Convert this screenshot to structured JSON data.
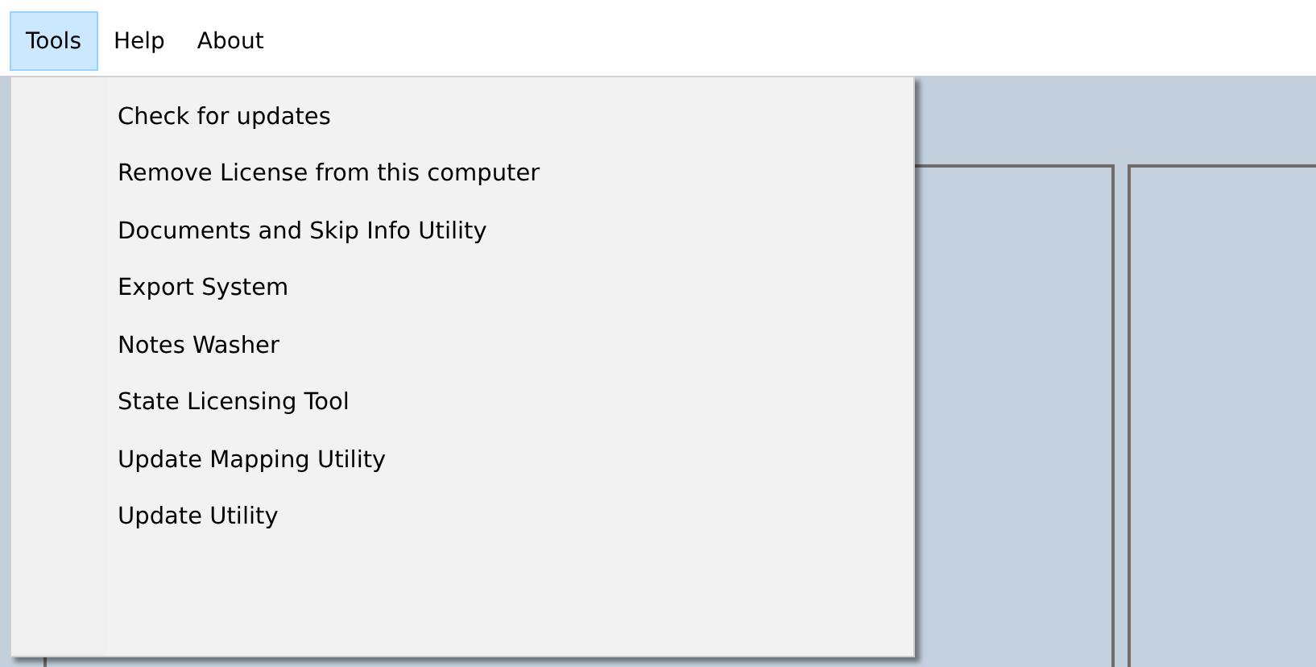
{
  "menu_bar": [
    {
      "label": "Tools",
      "selected": true
    },
    {
      "label": "Help",
      "selected": false
    },
    {
      "label": "About",
      "selected": false
    }
  ],
  "dropdown": {
    "items": [
      {
        "label": "Check for updates"
      },
      {
        "label": "Remove License from this computer"
      },
      {
        "label": "Documents and Skip Info Utility"
      },
      {
        "label": "Export System"
      },
      {
        "label": "Notes Washer"
      },
      {
        "label": "State Licensing Tool"
      },
      {
        "label": "Update Mapping Utility"
      },
      {
        "label": "Update Utility"
      }
    ]
  }
}
